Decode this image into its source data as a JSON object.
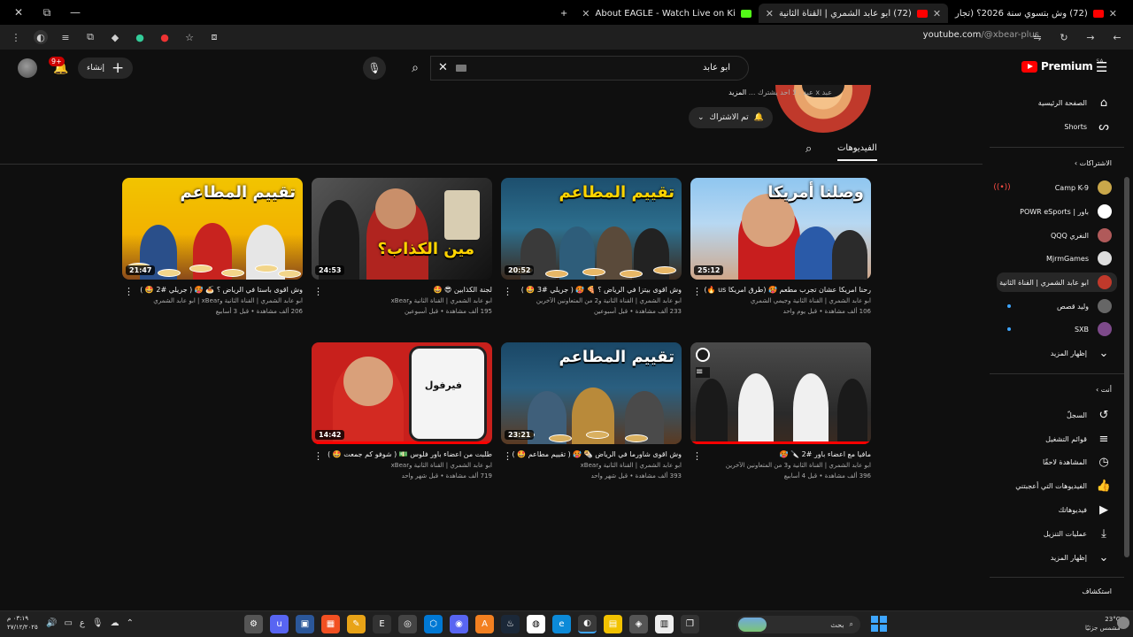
{
  "browser": {
    "tabs": [
      {
        "title": "(72) وش بتسوي سنة 2026؟ (تجار",
        "active": false
      },
      {
        "title": "(72) ابو عابد الشمري | القناة الثانية",
        "active": true
      },
      {
        "title": "About EAGLE - Watch Live on Ki",
        "active": false
      }
    ],
    "url_host": "youtube.com",
    "url_path": "/@xbear-plus"
  },
  "header": {
    "logo": "Premium",
    "logo_cc": "SA",
    "search_query": "ابو عابد",
    "create_label": "إنشاء",
    "notif_count": "9+"
  },
  "channel": {
    "description_prefix": "عبد x عبد .",
    "description": " لا احد يشترك ...",
    "description_more": "المزيد",
    "subscribed_label": "تم الاشتراك",
    "tab_videos": "الفيديوهات"
  },
  "videos": [
    {
      "title": "رحنا امريكا عشان تجرب مطعم 🥵 (طرق امريكا us 🔥)",
      "channel": "ابو عابد الشمري | القناة الثانية وجيمي الشمري",
      "meta": "106 ألف مشاهدة • قبل يوم واحد",
      "duration": "25:12",
      "thumb_text": "وصلنا أمريكا",
      "progress": 0
    },
    {
      "title": "وش اقوى بيتزا في الرياض ؟ 🍕 🥵 ( جريلي #3 🤩 )",
      "channel": "ابو عابد الشمري | القناة الثانية و2 من المتعاونين الآخرين",
      "meta": "233 ألف مشاهدة • قبل أسبوعين",
      "duration": "20:52",
      "thumb_text": "تقييم المطاعم",
      "progress": 0
    },
    {
      "title": "لجنة الكذابين 😎 🤩",
      "channel": "ابو عابد الشمري | القناة الثانية وxBear",
      "meta": "195 ألف مشاهدة • قبل أسبوعين",
      "duration": "24:53",
      "thumb_text": "مين الكذاب؟",
      "progress": 0
    },
    {
      "title": "وش اقوى باستا في الرياض ؟ 🍝 🥵 ( جريلي #2 🤩 )",
      "channel": "ابو عابد الشمري | القناة الثانية وxBear | ابو عابد الشمري",
      "meta": "206 ألف مشاهدة • قبل 3 أسابيع",
      "duration": "21:47",
      "thumb_text": "تقييم المطاعم",
      "progress": 0
    },
    {
      "title": "مافيا مع اعضاء باور #2 🔪 🥵",
      "channel": "ابو عابد الشمري | القناة الثانية و3 من المتعاونين الآخرين",
      "meta": "396 ألف مشاهدة • قبل 4 أسابيع",
      "duration": "",
      "thumb_text": "",
      "progress": 1
    },
    {
      "title": "وش اقوى شاورما في الرياض 🌯 🥵 ( تقييم مطاعم 🤩 )",
      "channel": "ابو عابد الشمري | القناة الثانية وxBear",
      "meta": "393 ألف مشاهدة • قبل شهر واحد",
      "duration": "23:21",
      "thumb_text": "تقييم المطاعم",
      "progress": 0
    },
    {
      "title": "طلبت من اعضاء باور فلوس 💵 ( شوفو كم جمعت 🤩 )",
      "channel": "ابو عابد الشمري | القناة الثانية وxBear",
      "meta": "719 ألف مشاهدة • قبل شهر واحد",
      "duration": "14:42",
      "thumb_text": "فيرفول",
      "progress": 1
    }
  ],
  "sidebar": {
    "home": "الصفحة الرئيسية",
    "shorts": "Shorts",
    "subs_heading": "الاشتراكات",
    "subs": [
      {
        "name": "Camp K-9",
        "color": "#c9a74a",
        "live": true
      },
      {
        "name": "باور | POWR eSports",
        "color": "#ffffff",
        "live": false
      },
      {
        "name": "النغري QQQ",
        "color": "#b05a5a",
        "live": false
      },
      {
        "name": "MjrmGames",
        "color": "#dddddd",
        "live": false
      },
      {
        "name": "ابو عابد الشمري | القناة الثانية",
        "color": "#c0392b",
        "live": false,
        "selected": true
      },
      {
        "name": "وليد قصص",
        "color": "#666666",
        "live": false,
        "dot": true
      },
      {
        "name": "SXB",
        "color": "#7d4a8a",
        "live": false,
        "dot": true
      }
    ],
    "show_more": "إظهار المزيد",
    "you_heading": "أنت",
    "you_items": [
      "السجلّ",
      "قوائم التشغيل",
      "المشاهدة لاحقًا",
      "الفيديوهات التي أعجبتني",
      "فيديوهاتك",
      "عمليات التنزيل"
    ],
    "show_more_2": "إظهار المزيد",
    "explore": "استكشاف"
  },
  "taskbar": {
    "time": "٠٣:١٩ م",
    "date": "٢٧/١٢/٢٠٢٥",
    "search_label": "بحث",
    "temp": "23°C",
    "weather": "مشمس جزئيًا"
  }
}
